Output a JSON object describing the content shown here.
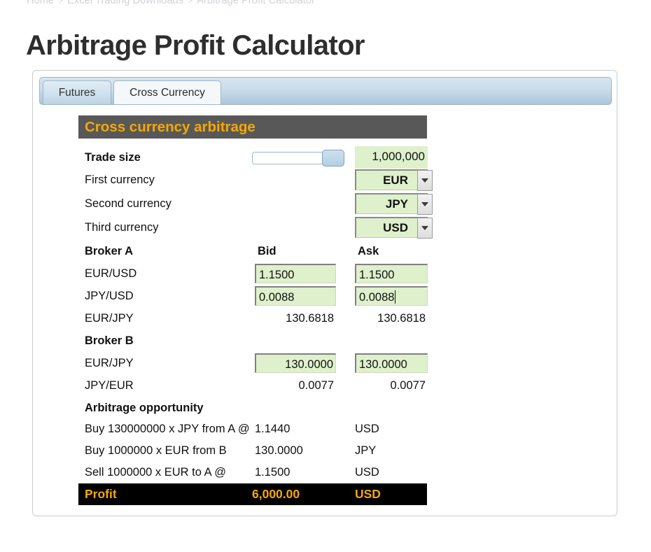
{
  "breadcrumb": {
    "items": [
      "Home",
      "Excel Trading Downloads",
      "Arbitrage Profit Calculator"
    ],
    "separator": ">"
  },
  "page_title": "Arbitrage Profit Calculator",
  "tabs": [
    {
      "label": "Futures",
      "active": false
    },
    {
      "label": "Cross Currency",
      "active": true
    }
  ],
  "section": {
    "title": "Cross currency arbitrage"
  },
  "inputs": {
    "trade_size_label": "Trade size",
    "trade_size_value": "1,000,000",
    "first_currency_label": "First currency",
    "first_currency_value": "EUR",
    "second_currency_label": "Second currency",
    "second_currency_value": "JPY",
    "third_currency_label": "Third currency",
    "third_currency_value": "USD"
  },
  "broker_a": {
    "title": "Broker A",
    "col_bid": "Bid",
    "col_ask": "Ask",
    "rows": [
      {
        "pair": "EUR/USD",
        "bid": "1.1500",
        "ask": "1.1500",
        "editable": true
      },
      {
        "pair": "JPY/USD",
        "bid": "0.0088",
        "ask": "0.0088",
        "editable": true
      },
      {
        "pair": "EUR/JPY",
        "bid": "130.6818",
        "ask": "130.6818",
        "editable": false
      }
    ]
  },
  "broker_b": {
    "title": "Broker B",
    "rows": [
      {
        "pair": "EUR/JPY",
        "bid": "130.0000",
        "ask": "130.0000",
        "editable": true
      },
      {
        "pair": "JPY/EUR",
        "bid": "0.0077",
        "ask": "0.0077",
        "editable": false
      }
    ]
  },
  "arbitrage": {
    "title": "Arbitrage opportunity",
    "rows": [
      {
        "text": "Buy 130000000 x JPY from A @",
        "rate": "1.1440",
        "currency": "USD"
      },
      {
        "text": "Buy 1000000 x EUR from B",
        "rate": "130.0000",
        "currency": "JPY"
      },
      {
        "text": "Sell 1000000 x EUR to A @",
        "rate": "1.1500",
        "currency": "USD"
      }
    ],
    "profit_label": "Profit",
    "profit_value": "6,000.00",
    "profit_currency": "USD"
  },
  "colors": {
    "accent_orange": "#f5a800",
    "section_grey": "#585858",
    "cell_green": "#dff0cc",
    "profit_black": "#000000"
  }
}
